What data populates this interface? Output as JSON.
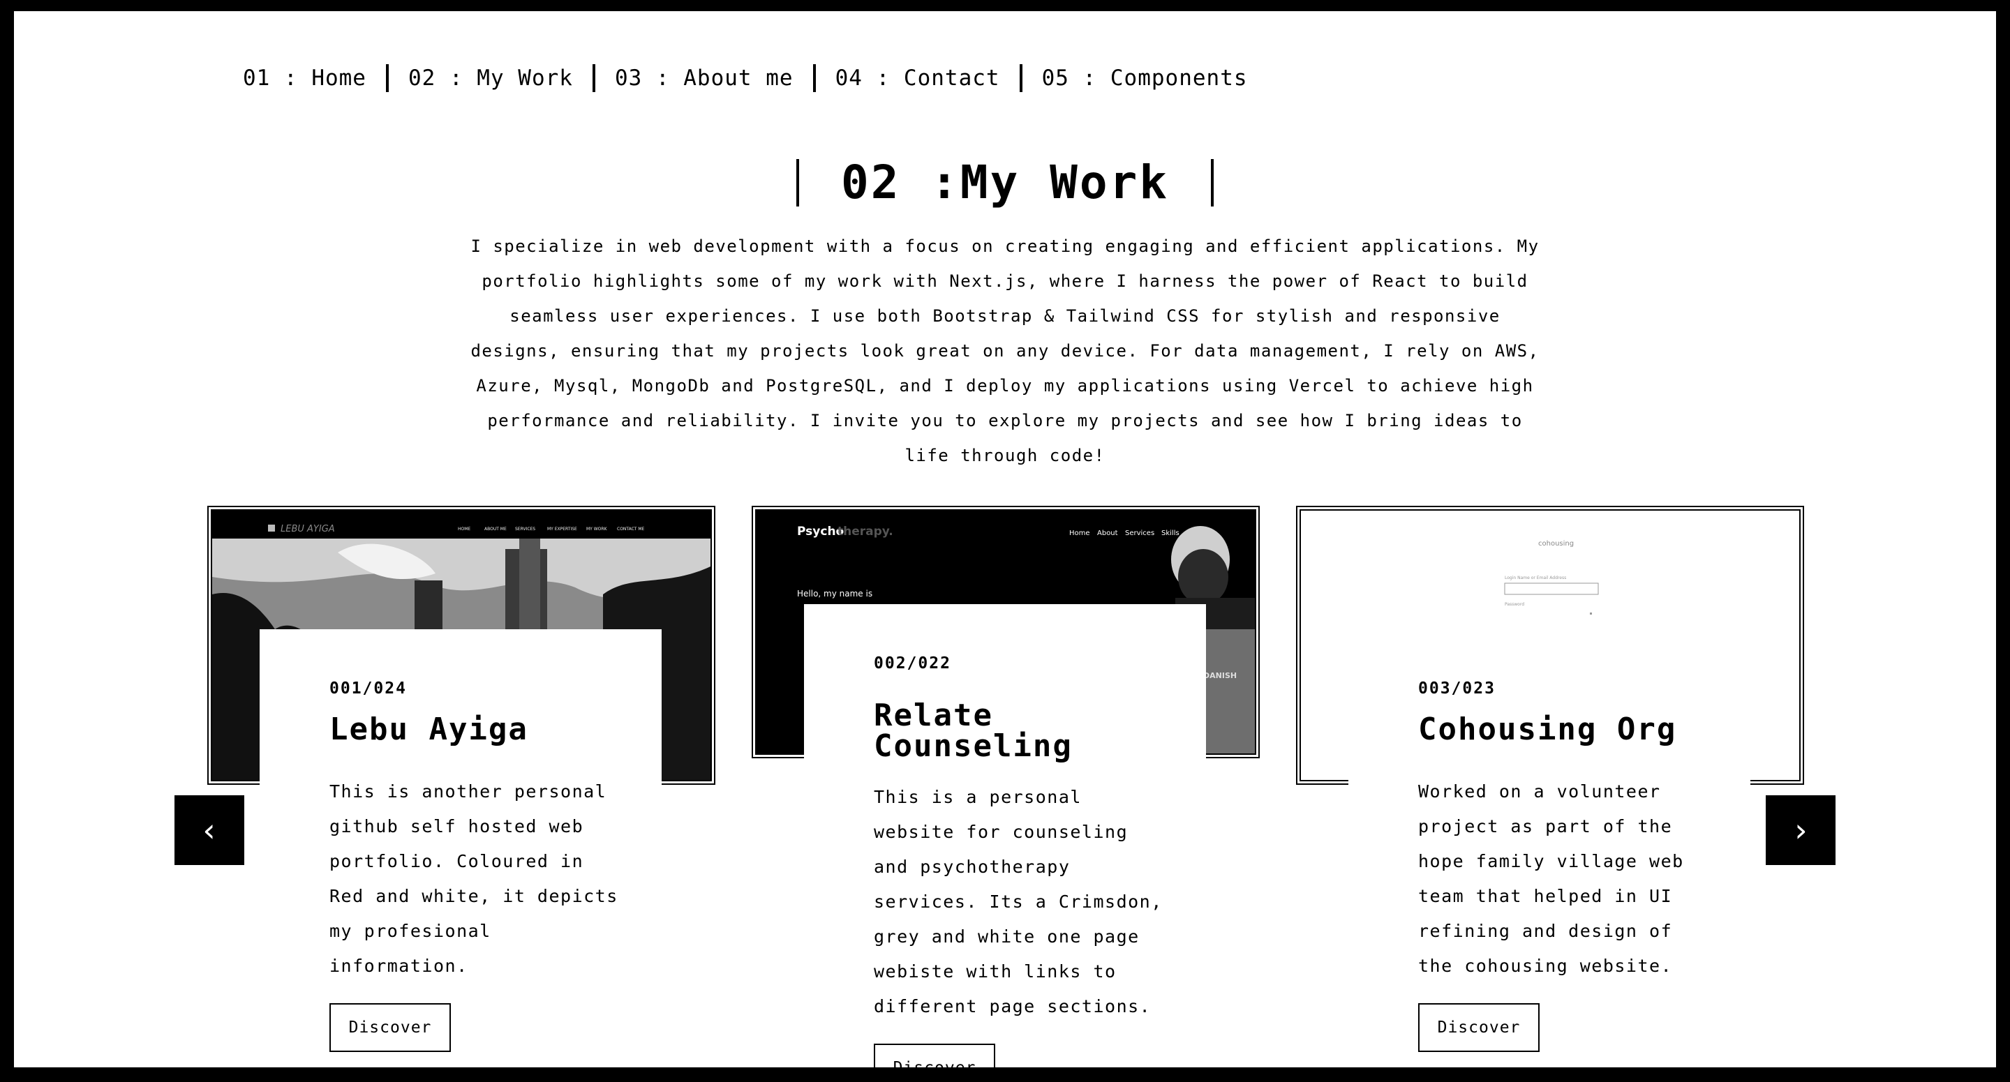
{
  "nav": [
    {
      "label": "01 : Home"
    },
    {
      "label": "02 : My Work"
    },
    {
      "label": "03 : About me"
    },
    {
      "label": "04 : Contact"
    },
    {
      "label": "05 : Components"
    }
  ],
  "heading": "02 :My Work",
  "intro": "I specialize in web development with a focus on creating engaging and efficient applications. My portfolio highlights some of my work with Next.js, where I harness the power of React to build seamless user experiences. I use both Bootstrap & Tailwind CSS for stylish and responsive designs, ensuring that my projects look great on any device. For data management, I rely on AWS, Azure, Mysql, MongoDb and PostgreSQL, and I deploy my applications using Vercel to achieve high performance and reliability. I invite you to explore my projects and see how I bring ideas to life through code!",
  "projects": [
    {
      "number": "001/024",
      "title": "Lebu Ayiga",
      "description": "This is another personal github self hosted web portfolio. Coloured in Red and white, it depicts my profesional information.",
      "button": "Discover",
      "preview": {
        "brand": "LEBU AYIGA",
        "menu": [
          "HOME",
          "ABOUT ME",
          "SERVICES",
          "MY EXPERTISE",
          "MY WORK",
          "CONTACT ME"
        ]
      }
    },
    {
      "number": "002/022",
      "title": "Relate Counseling",
      "description": "This is a personal website for counseling and psychotherapy services. Its a Crimsdon, grey and white one page webiste with links to different page sections.",
      "button": "Discover",
      "preview": {
        "brand_a": "Psycho",
        "brand_b": "therapy.",
        "menu": [
          "Home",
          "About",
          "Services",
          "Skills"
        ],
        "greeting": "Hello, my name is"
      }
    },
    {
      "number": "003/023",
      "title": "Cohousing Org",
      "description": "Worked on a volunteer project as part of the hope family village web team that helped in UI refining and design of the cohousing website.",
      "button": "Discover",
      "preview": {
        "logo": "cohousing",
        "field_label": "Login Name or Email Address",
        "field2_label": "Password"
      }
    }
  ],
  "controls": {
    "prev": "‹",
    "next": "›"
  }
}
